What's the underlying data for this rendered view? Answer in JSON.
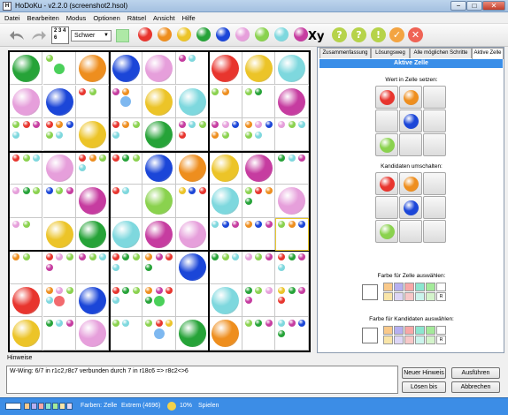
{
  "window": {
    "title": "HoDoKu - v2.2.0  (screenshot2.hsol)",
    "min": "−",
    "max": "□",
    "close": "✕"
  },
  "menu": [
    "Datei",
    "Bearbeiten",
    "Modus",
    "Optionen",
    "Rätsel",
    "Ansicht",
    "Hilfe"
  ],
  "toolbar": {
    "level": "Schwer",
    "grid_icon": "2 3 4 6",
    "xy": "Xy",
    "yellow_labels": [
      "?",
      "?",
      "!"
    ]
  },
  "colors": {
    "1": "#e8352e",
    "2": "#ee8e1e",
    "3": "#ecc428",
    "4": "#26a338",
    "5": "#1b46d8",
    "6": "#e69fdb",
    "7": "#8ad24e",
    "8": "#7ed8de",
    "9": "#c63ca0",
    "hint_red": "#f26a6e",
    "hint_green": "#4ad05a",
    "hint_blue": "#7eb8f0",
    "status_bar": "#3c8de6",
    "accent": "#3a8ee8"
  },
  "grid": {
    "values": [
      [
        4,
        0,
        2,
        5,
        6,
        0,
        1,
        3,
        8
      ],
      [
        6,
        5,
        0,
        0,
        3,
        8,
        0,
        0,
        9
      ],
      [
        0,
        0,
        3,
        0,
        4,
        0,
        0,
        0,
        0
      ],
      [
        0,
        6,
        0,
        0,
        5,
        2,
        3,
        9,
        0
      ],
      [
        0,
        0,
        9,
        0,
        7,
        0,
        8,
        0,
        6
      ],
      [
        0,
        3,
        4,
        8,
        9,
        6,
        0,
        0,
        0
      ],
      [
        0,
        0,
        0,
        0,
        0,
        5,
        0,
        0,
        0
      ],
      [
        1,
        0,
        5,
        0,
        0,
        0,
        8,
        0,
        0
      ],
      [
        3,
        0,
        6,
        0,
        0,
        4,
        2,
        0,
        0
      ]
    ],
    "candidates": [
      [
        [],
        [
          7
        ],
        [],
        [],
        [],
        [
          9,
          8
        ],
        [],
        [],
        []
      ],
      [
        [],
        [],
        [
          1,
          7
        ],
        [
          9,
          2
        ],
        [],
        [],
        [
          7,
          2
        ],
        [
          7,
          4
        ],
        []
      ],
      [
        [
          7,
          1,
          9,
          8
        ],
        [
          1,
          2,
          5,
          7,
          8
        ],
        [],
        [
          1,
          2,
          7,
          8
        ],
        [],
        [
          9,
          8,
          7,
          1
        ],
        [
          9,
          6,
          5,
          2,
          7
        ],
        [
          2,
          6,
          5,
          7,
          8
        ],
        [
          6,
          7,
          8
        ]
      ],
      [
        [
          1,
          7,
          8
        ],
        [],
        [
          1,
          2,
          7,
          8
        ],
        [
          1,
          4,
          7
        ],
        [],
        [],
        [],
        [],
        [
          4,
          8,
          9
        ]
      ],
      [
        [
          6,
          4,
          7
        ],
        [
          5,
          7,
          9
        ],
        [],
        [
          1,
          8
        ],
        [],
        [
          3,
          5,
          1
        ],
        [],
        [
          7,
          1,
          2,
          4
        ],
        []
      ],
      [
        [
          6,
          7
        ],
        [],
        [],
        [],
        [],
        [],
        [
          8,
          5,
          9
        ],
        [
          2,
          5,
          9
        ],
        [
          7,
          2,
          5
        ]
      ],
      [
        [
          2,
          7
        ],
        [
          1,
          6,
          7,
          9
        ],
        [
          9,
          7,
          8
        ],
        [
          1,
          4,
          7,
          8
        ],
        [
          2,
          9,
          1,
          4
        ],
        [],
        [
          4,
          7,
          8
        ],
        [
          6,
          7,
          9
        ],
        [
          1,
          4,
          9,
          8
        ]
      ],
      [
        [],
        [
          2,
          6,
          7,
          8
        ],
        [],
        [
          1,
          4,
          7,
          8
        ],
        [
          2,
          9,
          1,
          4
        ],
        [],
        [],
        [
          4,
          7,
          6,
          9
        ],
        [
          3,
          4,
          9,
          1
        ]
      ],
      [
        [],
        [
          4,
          8,
          9
        ],
        [],
        [
          7,
          8
        ],
        [
          7,
          1,
          3
        ],
        [],
        [],
        [
          7,
          4,
          9
        ],
        [
          8,
          9,
          5,
          4
        ]
      ]
    ],
    "hints": [
      {
        "r": 0,
        "c": 1,
        "color": "hint_green"
      },
      {
        "r": 1,
        "c": 3,
        "color": "hint_blue"
      },
      {
        "r": 7,
        "c": 1,
        "color": "hint_red"
      },
      {
        "r": 7,
        "c": 4,
        "color": "hint_green"
      },
      {
        "r": 8,
        "c": 4,
        "color": "hint_blue"
      }
    ]
  },
  "panel": {
    "tabs": [
      "Zusammenfassung",
      "Lösungsweg",
      "Alle möglichen Schritte",
      "Aktive Zelle"
    ],
    "title": "Aktive Zelle",
    "set_label": "Wert in Zelle setzen:",
    "set_buttons": [
      1,
      2,
      0,
      0,
      5,
      0,
      7,
      0,
      0
    ],
    "toggle_label": "Kandidaten umschalten:",
    "toggle_buttons": [
      1,
      2,
      0,
      0,
      5,
      0,
      7,
      0,
      0
    ],
    "cell_color_label": "Farbe für Zelle auswählen:",
    "cand_color_label": "Farbe für Kandidaten auswählen:",
    "swatch_colors": [
      "#f9c98a",
      "#b6aff0",
      "#f8a7a7",
      "#8ce6cf",
      "#a4ea9a",
      "#f9e5a8",
      "#ddd6f6",
      "#f7c8c8",
      "#cbf4ec",
      "#d4f4cb"
    ],
    "reset": "R"
  },
  "hints_label": "Hinweise",
  "hint_text": "W-Wing: 6/7 in r1c2,r8c7 verbunden durch 7 in r18c6 => r8c2<>6",
  "buttons": {
    "new_hint": "Neuer Hinweis",
    "apply": "Ausführen",
    "solve_to": "Lösen bis",
    "cancel": "Abbrechen"
  },
  "status": {
    "colors_label": "Farben: Zelle",
    "level": "Extrem (4696)",
    "progress": "10%",
    "mode": "Spielen",
    "progress_fraction": 0.1
  }
}
